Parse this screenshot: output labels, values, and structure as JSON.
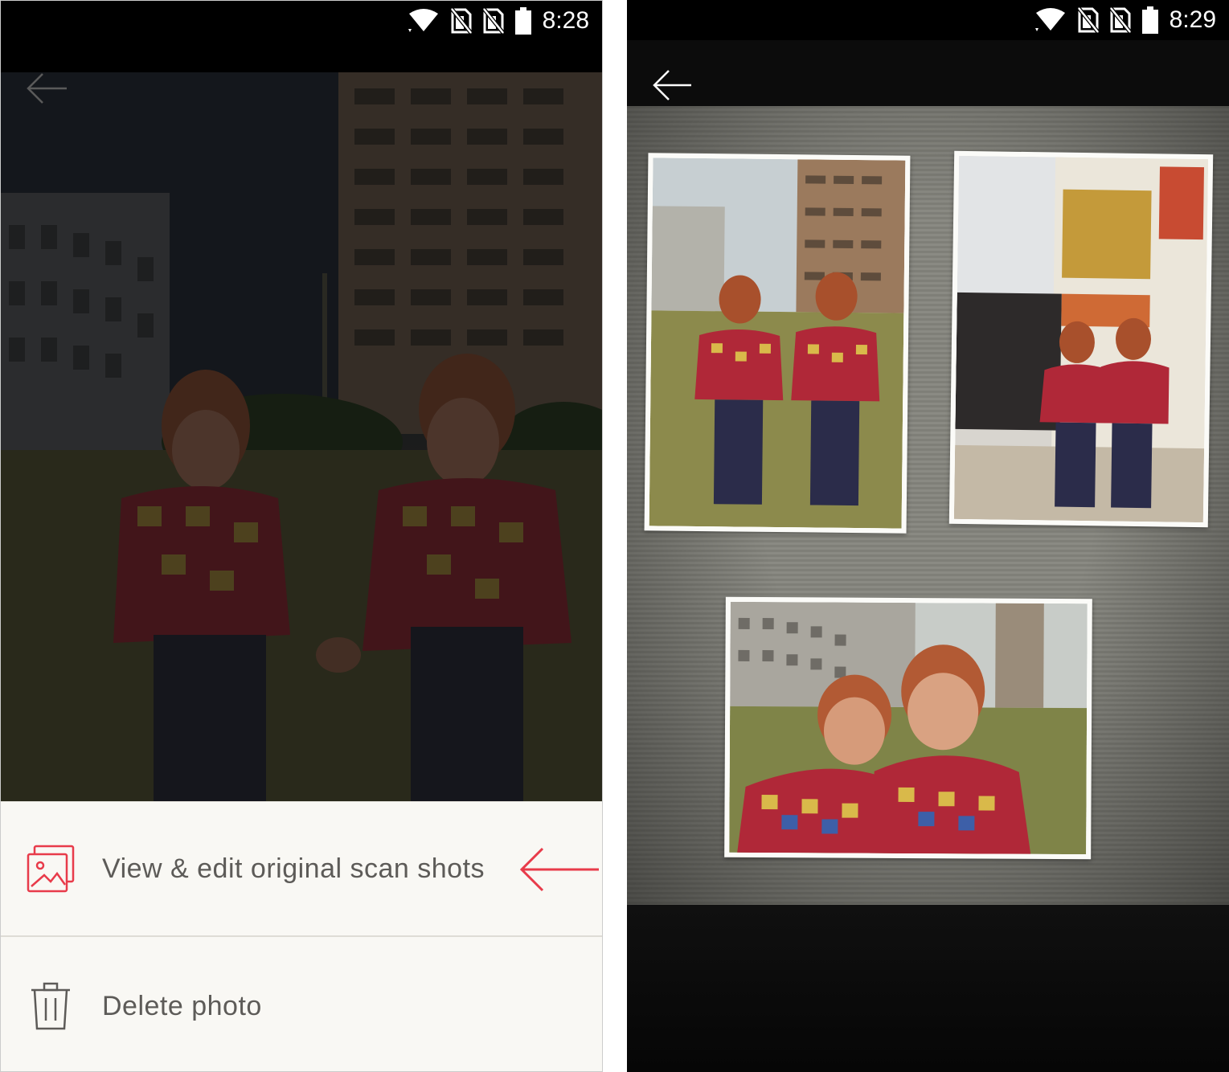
{
  "left_screen": {
    "status_bar": {
      "time": "8:28"
    },
    "bottom_sheet": {
      "items": [
        {
          "label": "View & edit original scan shots",
          "icon": "photos-icon"
        },
        {
          "label": "Delete photo",
          "icon": "trash-icon"
        }
      ]
    },
    "accent_color": "#e83b4a"
  },
  "right_screen": {
    "status_bar": {
      "time": "8:29"
    }
  }
}
